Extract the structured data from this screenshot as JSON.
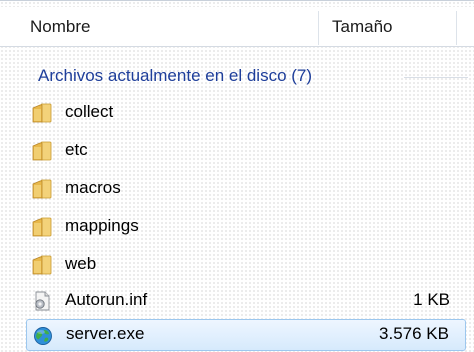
{
  "columns": {
    "name": "Nombre",
    "size": "Tamaño"
  },
  "group": {
    "title": "Archivos actualmente en el disco (7)"
  },
  "items": [
    {
      "name": "collect",
      "size": "",
      "icon": "folder-icon",
      "selected": false
    },
    {
      "name": "etc",
      "size": "",
      "icon": "folder-icon",
      "selected": false
    },
    {
      "name": "macros",
      "size": "",
      "icon": "folder-icon",
      "selected": false
    },
    {
      "name": "mappings",
      "size": "",
      "icon": "folder-icon",
      "selected": false
    },
    {
      "name": "web",
      "size": "",
      "icon": "folder-icon",
      "selected": false
    },
    {
      "name": "Autorun.inf",
      "size": "1 KB",
      "icon": "settings-file-icon",
      "selected": false
    },
    {
      "name": "server.exe",
      "size": "3.576 KB",
      "icon": "globe-exe-icon",
      "selected": true
    }
  ],
  "colors": {
    "group_heading": "#1e3e9a",
    "selection_border": "#9cc7ee",
    "folder": "#e8b84a"
  }
}
